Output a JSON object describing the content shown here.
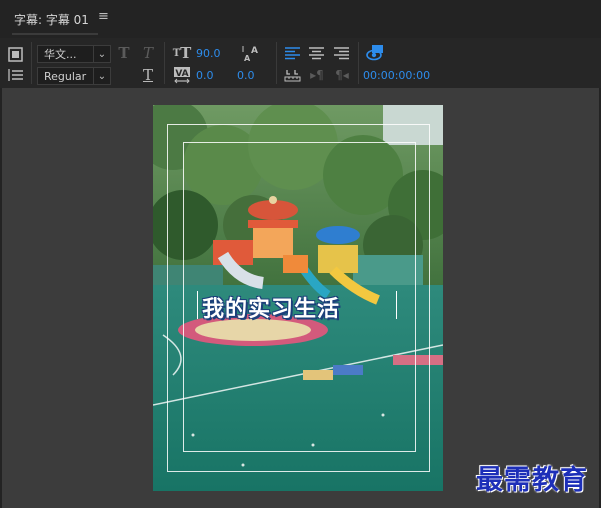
{
  "panel": {
    "title": "字幕: 字幕 01",
    "menu_icon": "hamburger-menu-icon"
  },
  "toolbar": {
    "font_family": "华文...",
    "font_style": "Regular",
    "font_size": "90.0",
    "kerning": "0.0",
    "tracking": "0.0",
    "timecode": "00:00:00:00",
    "bold_glyph": "T",
    "italic_glyph": "T",
    "underline_glyph": "T"
  },
  "caption": {
    "text": "我的实习生活"
  },
  "watermark": {
    "text": "最需教育"
  },
  "colors": {
    "accent": "#2d8ceb",
    "panel_bg": "#232323",
    "viewer_bg": "#3c3c3c",
    "caption_stroke": "#1b3f7a",
    "watermark": "#1d2fb8"
  }
}
